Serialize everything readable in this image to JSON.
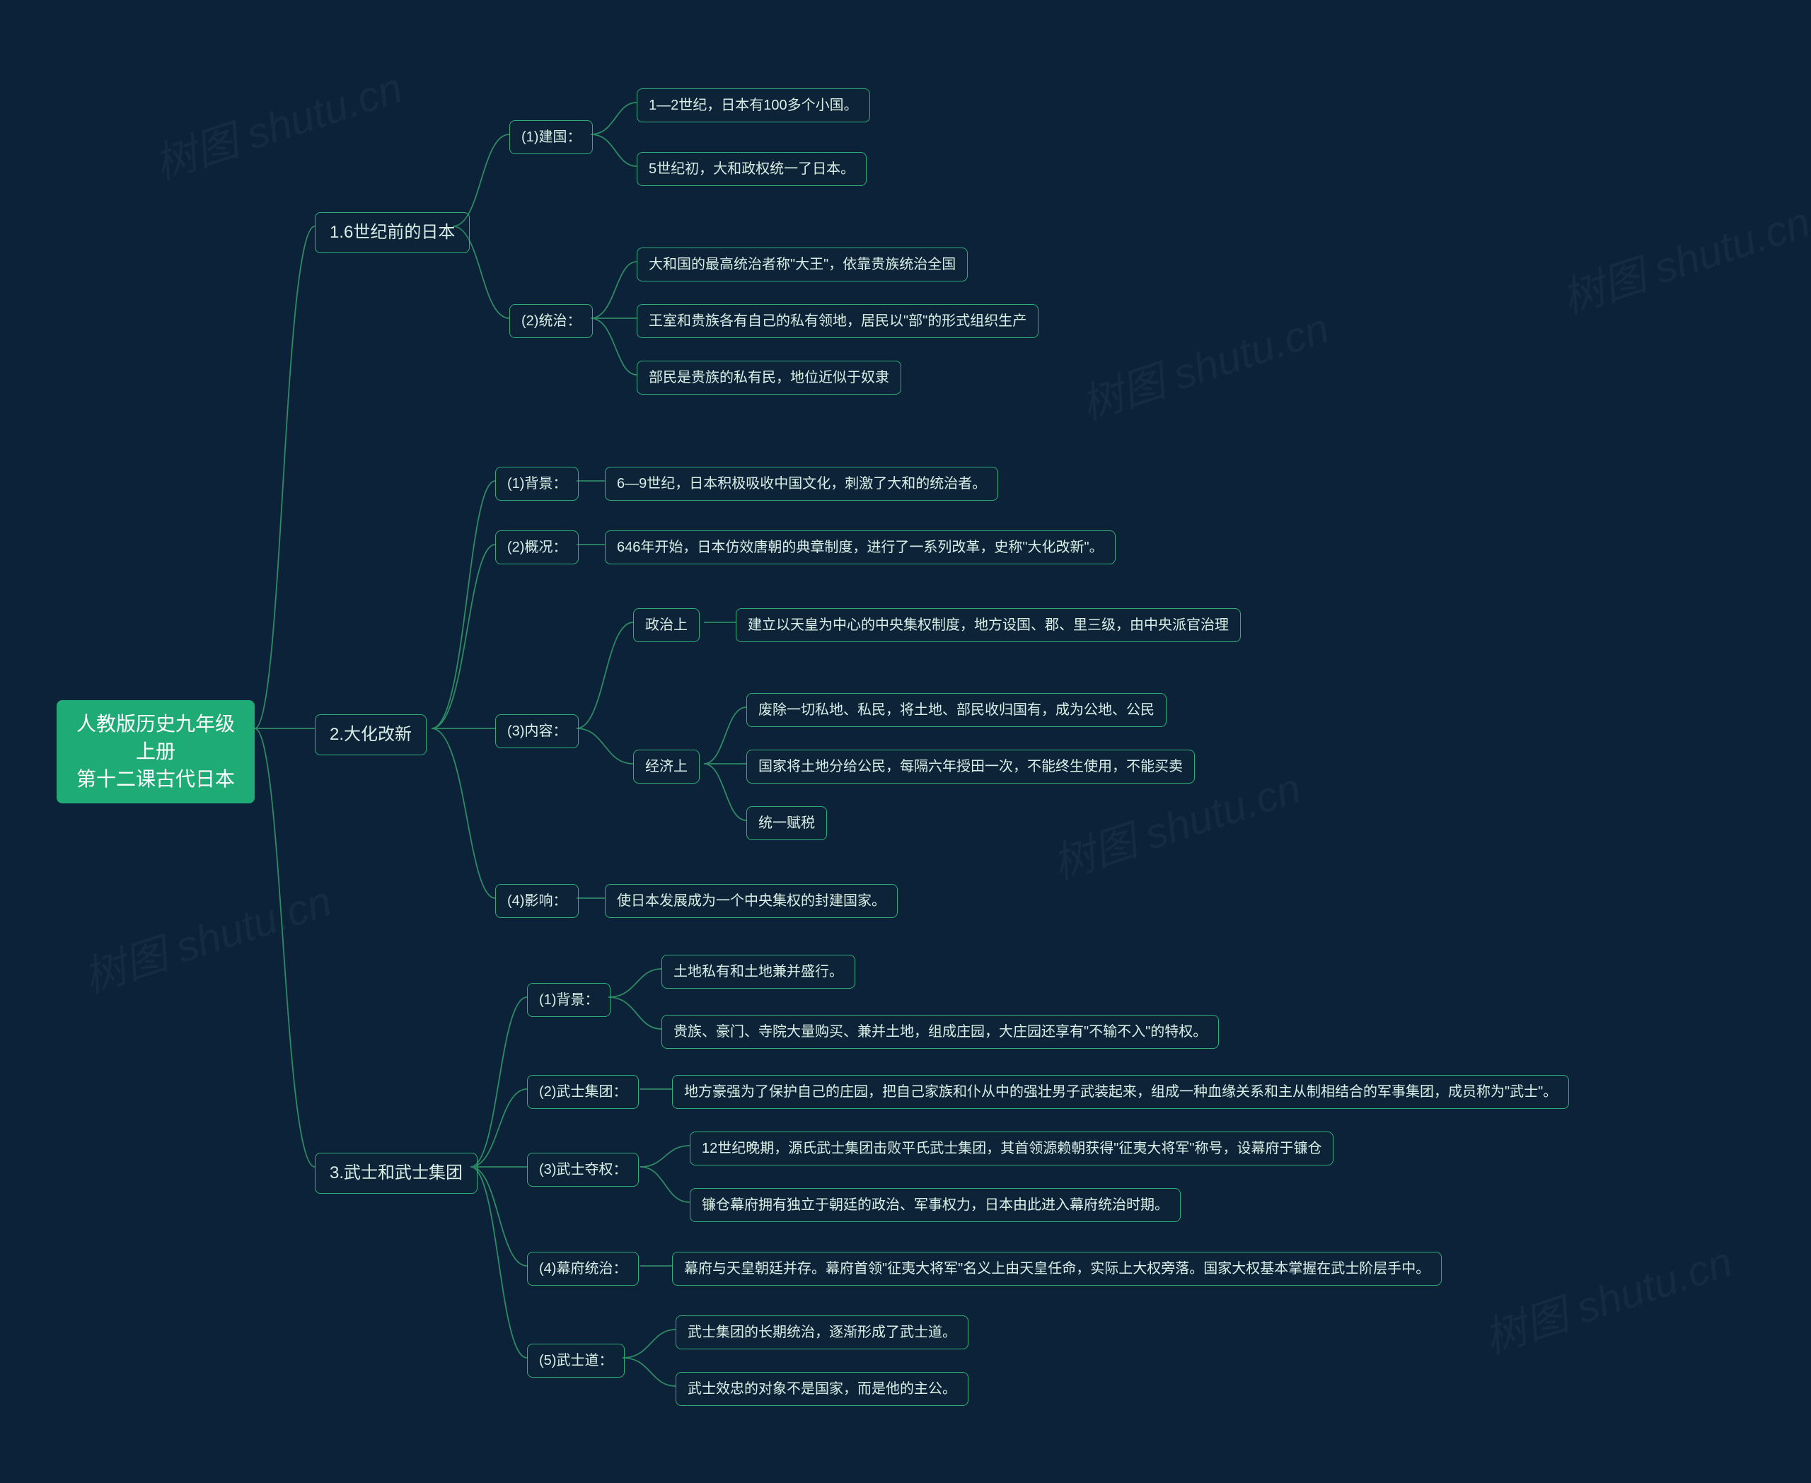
{
  "watermark_text": "树图 shutu.cn",
  "root": {
    "title": "人教版历史九年级上册\n第十二课古代日本"
  },
  "sections": [
    {
      "label": "1.6世纪前的日本",
      "children": [
        {
          "label": "(1)建国：",
          "children": [
            {
              "label": "1—2世纪，日本有100多个小国。"
            },
            {
              "label": "5世纪初，大和政权统一了日本。"
            }
          ]
        },
        {
          "label": "(2)统治：",
          "children": [
            {
              "label": "大和国的最高统治者称\"大王\"，依靠贵族统治全国"
            },
            {
              "label": "王室和贵族各有自己的私有领地，居民以\"部\"的形式组织生产"
            },
            {
              "label": "部民是贵族的私有民，地位近似于奴隶"
            }
          ]
        }
      ]
    },
    {
      "label": "2.大化改新",
      "children": [
        {
          "label": "(1)背景：",
          "children": [
            {
              "label": "6—9世纪，日本积极吸收中国文化，刺激了大和的统治者。"
            }
          ]
        },
        {
          "label": "(2)概况：",
          "children": [
            {
              "label": "646年开始，日本仿效唐朝的典章制度，进行了一系列改革，史称\"大化改新\"。"
            }
          ]
        },
        {
          "label": "(3)内容：",
          "children": [
            {
              "label": "政治上",
              "children": [
                {
                  "label": "建立以天皇为中心的中央集权制度，地方设国、郡、里三级，由中央派官治理"
                }
              ]
            },
            {
              "label": "经济上",
              "children": [
                {
                  "label": "废除一切私地、私民，将土地、部民收归国有，成为公地、公民"
                },
                {
                  "label": "国家将土地分给公民，每隔六年授田一次，不能终生使用，不能买卖"
                },
                {
                  "label": "统一赋税"
                }
              ]
            }
          ]
        },
        {
          "label": "(4)影响：",
          "children": [
            {
              "label": "使日本发展成为一个中央集权的封建国家。"
            }
          ]
        }
      ]
    },
    {
      "label": "3.武士和武士集团",
      "children": [
        {
          "label": "(1)背景：",
          "children": [
            {
              "label": "土地私有和土地兼并盛行。"
            },
            {
              "label": "贵族、豪门、寺院大量购买、兼并土地，组成庄园，大庄园还享有\"不输不入\"的特权。"
            }
          ]
        },
        {
          "label": "(2)武士集团：",
          "children": [
            {
              "label": "地方豪强为了保护自己的庄园，把自己家族和仆从中的强壮男子武装起来，组成一种血缘关系和主从制相结合的军事集团，成员称为\"武士\"。"
            }
          ]
        },
        {
          "label": "(3)武士夺权：",
          "children": [
            {
              "label": "12世纪晚期，源氏武士集团击败平氏武士集团，其首领源赖朝获得\"征夷大将军\"称号，设幕府于镰仓"
            },
            {
              "label": "镰仓幕府拥有独立于朝廷的政治、军事权力，日本由此进入幕府统治时期。"
            }
          ]
        },
        {
          "label": "(4)幕府统治：",
          "children": [
            {
              "label": "幕府与天皇朝廷并存。幕府首领\"征夷大将军\"名义上由天皇任命，实际上大权旁落。国家大权基本掌握在武士阶层手中。"
            }
          ]
        },
        {
          "label": "(5)武士道：",
          "children": [
            {
              "label": "武士集团的长期统治，逐渐形成了武士道。"
            },
            {
              "label": "武士效忠的对象不是国家，而是他的主公。"
            }
          ]
        }
      ]
    }
  ],
  "colors": {
    "background": "#0c2238",
    "node_border": "#2fae79",
    "root_fill": "#1fab76",
    "connector": "#2e8a64"
  }
}
